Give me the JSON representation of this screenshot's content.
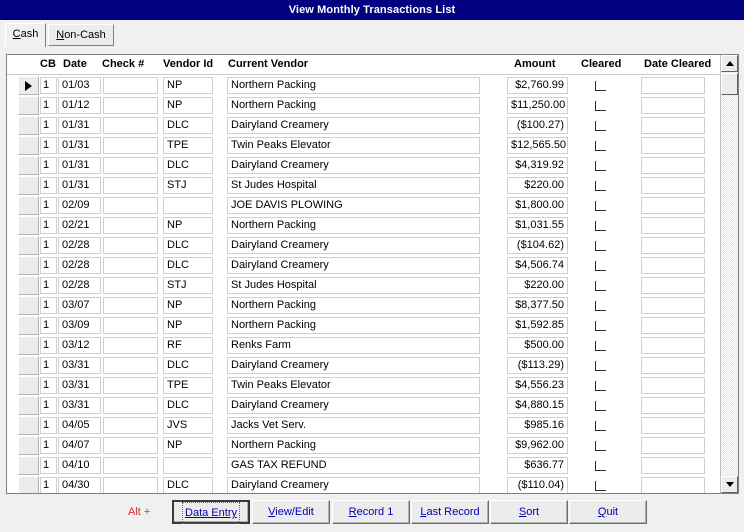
{
  "window": {
    "title": "View Monthly Transactions List"
  },
  "tabs": [
    {
      "id": "cash",
      "label": "Cash",
      "accel": "C",
      "active": true
    },
    {
      "id": "non-cash",
      "label": "Non-Cash",
      "accel": "N",
      "active": false
    }
  ],
  "grid": {
    "columns": [
      {
        "key": "cb",
        "label": "CB"
      },
      {
        "key": "date",
        "label": "Date"
      },
      {
        "key": "check",
        "label": "Check #"
      },
      {
        "key": "vendor_id",
        "label": "Vendor Id"
      },
      {
        "key": "vendor",
        "label": "Current Vendor"
      },
      {
        "key": "amount",
        "label": "Amount"
      },
      {
        "key": "cleared",
        "label": "Cleared"
      },
      {
        "key": "date_cleared",
        "label": "Date Cleared"
      }
    ],
    "selected_row_index": 0,
    "rows": [
      {
        "cb": "1",
        "date": "01/03",
        "check": "",
        "vendor_id": "NP",
        "vendor": "Northern Packing",
        "amount": "$2,760.99",
        "cleared": false,
        "date_cleared": ""
      },
      {
        "cb": "1",
        "date": "01/12",
        "check": "",
        "vendor_id": "NP",
        "vendor": "Northern Packing",
        "amount": "$11,250.00",
        "cleared": false,
        "date_cleared": ""
      },
      {
        "cb": "1",
        "date": "01/31",
        "check": "",
        "vendor_id": "DLC",
        "vendor": "Dairyland Creamery",
        "amount": "($100.27)",
        "cleared": false,
        "date_cleared": ""
      },
      {
        "cb": "1",
        "date": "01/31",
        "check": "",
        "vendor_id": "TPE",
        "vendor": "Twin Peaks Elevator",
        "amount": "$12,565.50",
        "cleared": false,
        "date_cleared": ""
      },
      {
        "cb": "1",
        "date": "01/31",
        "check": "",
        "vendor_id": "DLC",
        "vendor": "Dairyland Creamery",
        "amount": "$4,319.92",
        "cleared": false,
        "date_cleared": ""
      },
      {
        "cb": "1",
        "date": "01/31",
        "check": "",
        "vendor_id": "STJ",
        "vendor": "St Judes Hospital",
        "amount": "$220.00",
        "cleared": false,
        "date_cleared": ""
      },
      {
        "cb": "1",
        "date": "02/09",
        "check": "",
        "vendor_id": "",
        "vendor": "JOE DAVIS PLOWING",
        "amount": "$1,800.00",
        "cleared": false,
        "date_cleared": ""
      },
      {
        "cb": "1",
        "date": "02/21",
        "check": "",
        "vendor_id": "NP",
        "vendor": "Northern Packing",
        "amount": "$1,031.55",
        "cleared": false,
        "date_cleared": ""
      },
      {
        "cb": "1",
        "date": "02/28",
        "check": "",
        "vendor_id": "DLC",
        "vendor": "Dairyland Creamery",
        "amount": "($104.62)",
        "cleared": false,
        "date_cleared": ""
      },
      {
        "cb": "1",
        "date": "02/28",
        "check": "",
        "vendor_id": "DLC",
        "vendor": "Dairyland Creamery",
        "amount": "$4,506.74",
        "cleared": false,
        "date_cleared": ""
      },
      {
        "cb": "1",
        "date": "02/28",
        "check": "",
        "vendor_id": "STJ",
        "vendor": "St Judes Hospital",
        "amount": "$220.00",
        "cleared": false,
        "date_cleared": ""
      },
      {
        "cb": "1",
        "date": "03/07",
        "check": "",
        "vendor_id": "NP",
        "vendor": "Northern Packing",
        "amount": "$8,377.50",
        "cleared": false,
        "date_cleared": ""
      },
      {
        "cb": "1",
        "date": "03/09",
        "check": "",
        "vendor_id": "NP",
        "vendor": "Northern Packing",
        "amount": "$1,592.85",
        "cleared": false,
        "date_cleared": ""
      },
      {
        "cb": "1",
        "date": "03/12",
        "check": "",
        "vendor_id": "RF",
        "vendor": "Renks Farm",
        "amount": "$500.00",
        "cleared": false,
        "date_cleared": ""
      },
      {
        "cb": "1",
        "date": "03/31",
        "check": "",
        "vendor_id": "DLC",
        "vendor": "Dairyland Creamery",
        "amount": "($113.29)",
        "cleared": false,
        "date_cleared": ""
      },
      {
        "cb": "1",
        "date": "03/31",
        "check": "",
        "vendor_id": "TPE",
        "vendor": "Twin Peaks Elevator",
        "amount": "$4,556.23",
        "cleared": false,
        "date_cleared": ""
      },
      {
        "cb": "1",
        "date": "03/31",
        "check": "",
        "vendor_id": "DLC",
        "vendor": "Dairyland Creamery",
        "amount": "$4,880.15",
        "cleared": false,
        "date_cleared": ""
      },
      {
        "cb": "1",
        "date": "04/05",
        "check": "",
        "vendor_id": "JVS",
        "vendor": "Jacks Vet Serv.",
        "amount": "$985.16",
        "cleared": false,
        "date_cleared": ""
      },
      {
        "cb": "1",
        "date": "04/07",
        "check": "",
        "vendor_id": "NP",
        "vendor": "Northern Packing",
        "amount": "$9,962.00",
        "cleared": false,
        "date_cleared": ""
      },
      {
        "cb": "1",
        "date": "04/10",
        "check": "",
        "vendor_id": "",
        "vendor": "GAS TAX REFUND",
        "amount": "$636.77",
        "cleared": false,
        "date_cleared": ""
      },
      {
        "cb": "1",
        "date": "04/30",
        "check": "",
        "vendor_id": "DLC",
        "vendor": "Dairyland Creamery",
        "amount": "($110.04)",
        "cleared": false,
        "date_cleared": ""
      }
    ]
  },
  "scrollbar": {
    "up_icon": "scroll-up-arrow-icon",
    "down_icon": "scroll-down-arrow-icon"
  },
  "buttonbar": {
    "alt_label": "Alt +",
    "buttons": [
      {
        "id": "data-entry",
        "label": "Data Entry",
        "accel": "Data Entry",
        "focused": true
      },
      {
        "id": "view-edit",
        "label": "View/Edit",
        "accel": "V",
        "focused": false
      },
      {
        "id": "record-1",
        "label": "Record 1",
        "accel": "R",
        "focused": false
      },
      {
        "id": "last-record",
        "label": "Last Record",
        "accel": "L",
        "focused": false
      },
      {
        "id": "sort",
        "label": "Sort",
        "accel": "S",
        "focused": false
      },
      {
        "id": "quit",
        "label": "Quit",
        "accel": "Q",
        "focused": false
      }
    ]
  },
  "colors": {
    "titlebar_bg": "#000080",
    "titlebar_fg": "#ffffff",
    "button_fg": "#0000b4",
    "alt_fg": "#d13030",
    "app_bg": "#f0f0f0"
  }
}
